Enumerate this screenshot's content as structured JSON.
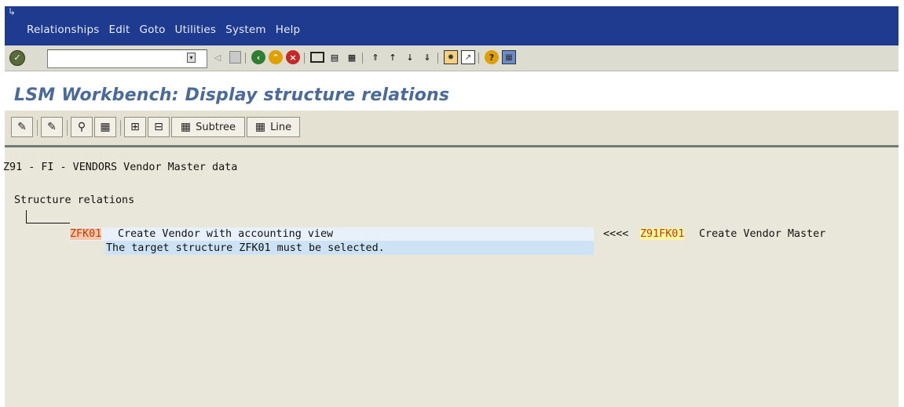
{
  "menubar": {
    "items": [
      "Relationships",
      "Edit",
      "Goto",
      "Utilities",
      "System",
      "Help"
    ],
    "color": "#1f3b8f"
  },
  "toolbar": {
    "command_field_value": ""
  },
  "title": "LSM Workbench: Display structure relations",
  "app_toolbar": {
    "subtree_label": "Subtree",
    "line_label": "Line"
  },
  "content": {
    "object_line": "Z91 - FI - VENDORS Vendor Master data",
    "section_title": "Structure relations",
    "target_code": "ZFK01",
    "target_desc": "Create Vendor with accounting view",
    "source_arrow": "<<<<",
    "source_code": "Z91FK01",
    "source_desc": "Create Vendor Master",
    "message": "The target structure ZFK01 must be selected."
  }
}
